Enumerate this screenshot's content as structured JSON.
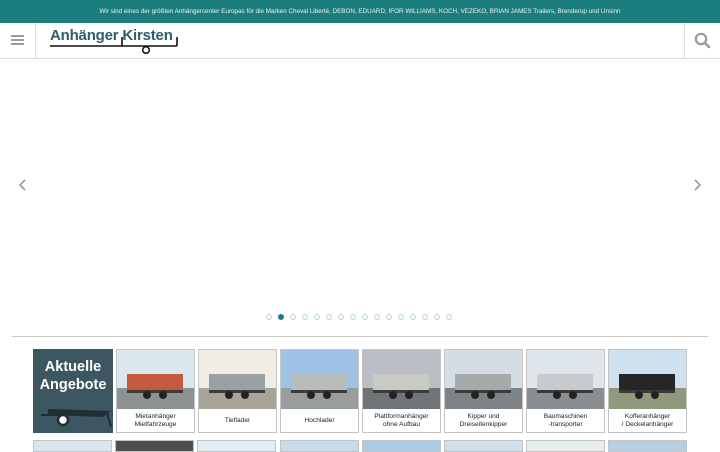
{
  "topbar": {
    "text": "Wir sind eines der größten Anhängercenter Europas für die Marken Cheval Liberté, DEBON, EDUARD, IFOR WILLIAMS, KOCH, VEZEKO, BRIAN JAMES Trailers, Brenderup und Unsinn"
  },
  "header": {
    "logo_text": "Anhänger Kirsten",
    "menu_icon": "hamburger-icon",
    "search_icon": "search-icon"
  },
  "slider": {
    "prev_icon": "chevron-left-icon",
    "next_icon": "chevron-right-icon",
    "dot_count": 16,
    "active_dot": 1
  },
  "offer": {
    "line1": "Aktuelle",
    "line2": "Angebote"
  },
  "categories": [
    {
      "label": "Mietanhänger\nMietfahrzeuge"
    },
    {
      "label": "Tieflader"
    },
    {
      "label": "Hochlader"
    },
    {
      "label": "Plattformanhänger\nohne Aufbau"
    },
    {
      "label": "Kipper und\nDreiseitenkipper"
    },
    {
      "label": "Baumaschinen\n-transporter"
    },
    {
      "label": "Kofferanhänger\n/ Deckelanhänger"
    }
  ],
  "colors": {
    "brand": "#1c7d7f",
    "logo": "#2e5d6e",
    "offer_bg": "#3c5662"
  }
}
